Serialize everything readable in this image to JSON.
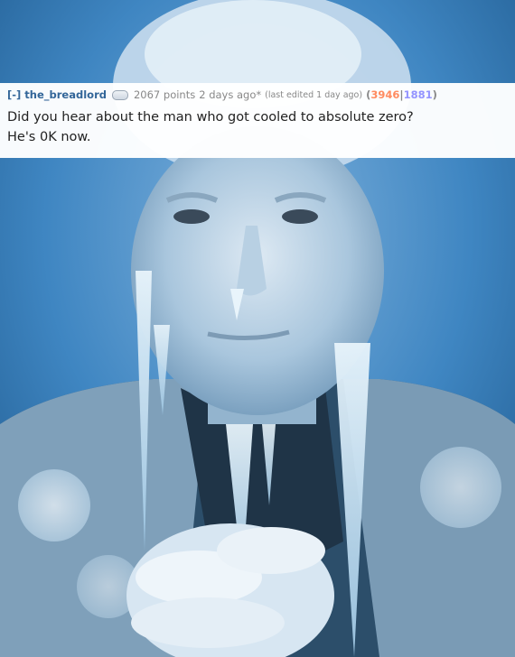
{
  "comment": {
    "expand_label": "[-]",
    "author": "the_breadlord",
    "points": "2067 points",
    "time": "2 days ago*",
    "edited": "(last edited 1 day ago)",
    "vote_open": "(",
    "upvotes": "3946",
    "vote_sep": "|",
    "downvotes": "1881",
    "vote_close": ")",
    "line1": "Did you hear about the man who got cooled to absolute zero?",
    "line2": "He's 0K now."
  },
  "icons": {
    "flair": "flair-icon"
  },
  "colors": {
    "author": "#336699",
    "upvotes": "#ff8b60",
    "downvotes": "#9494ff",
    "background": "#2e6fa6"
  }
}
